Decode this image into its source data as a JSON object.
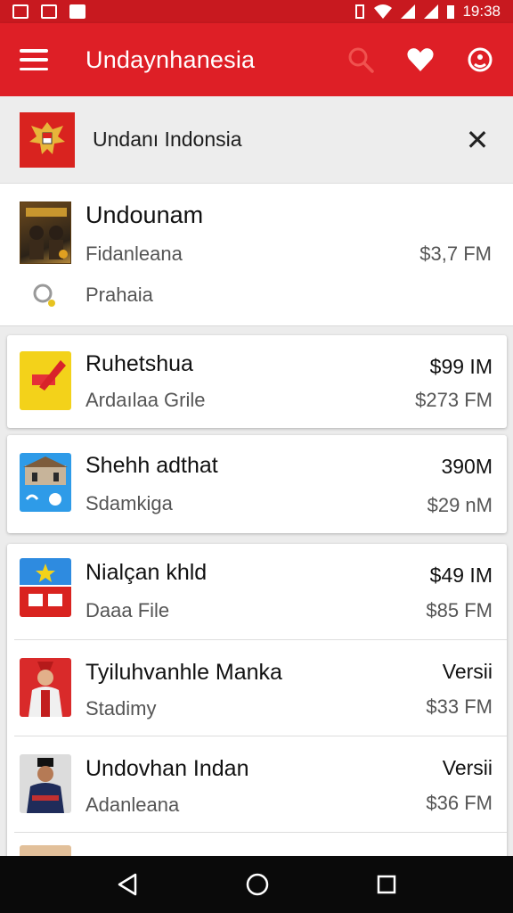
{
  "status_bar": {
    "time": "19:38"
  },
  "app_bar": {
    "title": "Undaynhanesia",
    "icons": [
      "menu-icon",
      "search-icon",
      "heart-icon",
      "account-icon"
    ]
  },
  "banner": {
    "text": "Undanı Indonsia",
    "close": "✕"
  },
  "featured": {
    "title": "Undounam",
    "subtitle": "Fidanleana",
    "price": "$3,7 FM",
    "tag": "Prahaia"
  },
  "cards": [
    {
      "title": "Ruhetshua",
      "subtitle": "Ardaılaa Grile",
      "right_top": "$99 IM",
      "right_bottom": "$273 FM"
    },
    {
      "title": "Shehh adthat",
      "subtitle": "Sdamkiga",
      "right_top": "390M",
      "right_bottom": "$29 nM"
    }
  ],
  "list": [
    {
      "title": "Nialçan khld",
      "subtitle": "Daaa File",
      "right_top": "$49 IM",
      "right_bottom": "$85 FM"
    },
    {
      "title": "Tyiluhvanhle Manka",
      "subtitle": "Stadimy",
      "right_top": "Versii",
      "right_bottom": "$33 FM"
    },
    {
      "title": "Undovhan Indan",
      "subtitle": "Adanleana",
      "right_top": "Versii",
      "right_bottom": "$36 FM"
    }
  ],
  "colors": {
    "primary": "#de1f26",
    "status": "#c8191f",
    "nav": "#0a0a0a"
  }
}
